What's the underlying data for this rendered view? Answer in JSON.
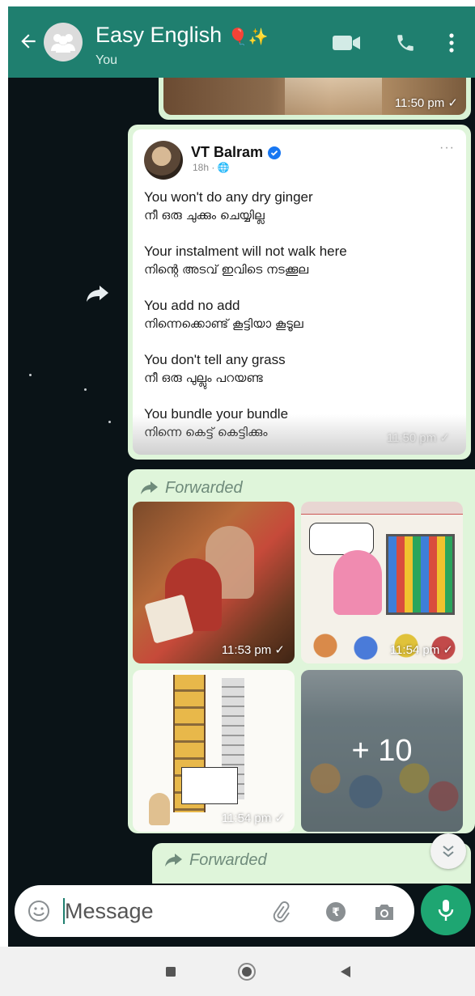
{
  "header": {
    "title": "Easy English",
    "title_emoji": "🎈✨",
    "subtitle": "You",
    "icons": [
      "back-arrow-icon",
      "group-avatar-icon",
      "video-call-icon",
      "phone-icon",
      "more-vert-icon"
    ],
    "color": "#1f7f6f"
  },
  "chat": {
    "background": "#0a1317",
    "messages": [
      {
        "type": "image",
        "time": "11:50 pm ✓"
      },
      {
        "type": "post-screenshot",
        "author": "VT Balram",
        "meta": "18h · 🌐",
        "more": "···",
        "lines": [
          {
            "en": "You won't do any dry ginger",
            "ml": "നീ ഒരു ചുക്കും ചെയ്യില്ല"
          },
          {
            "en": "Your instalment will not walk here",
            "ml": "നിന്റെ അടവ് ഇവിടെ നടക്കൂല"
          },
          {
            "en": "You add no add",
            "ml": "നിന്നെക്കൊണ്ട് കൂട്ടിയാ കൂടൂല"
          },
          {
            "en": "You don't tell any grass",
            "ml": "നീ ഒരു പുല്ലും പറയണ്ട"
          },
          {
            "en": "You bundle your bundle",
            "ml": "നിന്നെ കെട്ട് കെട്ടിക്കും"
          }
        ],
        "time": "11:50 pm ✓"
      },
      {
        "type": "album",
        "forwarded_label": "Forwarded",
        "tiles": [
          {
            "time": "11:53 pm ✓"
          },
          {
            "time": "11:54 pm ✓"
          },
          {
            "time": "11:54 pm ✓"
          },
          {
            "more": "+ 10"
          }
        ]
      },
      {
        "type": "forwarded-stub",
        "forwarded_label": "Forwarded"
      }
    ]
  },
  "composer": {
    "placeholder": "Message",
    "icons": [
      "emoji-icon",
      "attach-icon",
      "payment-icon",
      "camera-icon",
      "mic-icon"
    ],
    "mic_color": "#1ea672"
  },
  "navbar": {
    "icons": [
      "recents-icon",
      "home-icon",
      "back-icon"
    ]
  }
}
